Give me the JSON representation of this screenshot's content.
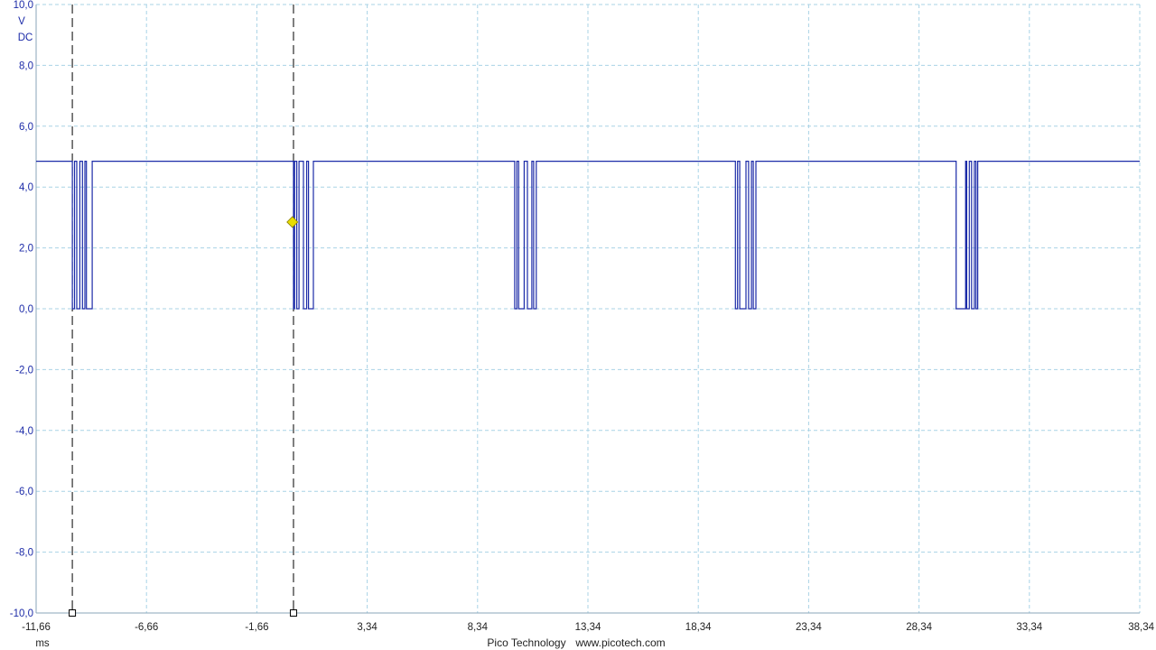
{
  "chart_data": {
    "type": "line",
    "title": "",
    "y_unit": "V",
    "y_coupling": "DC",
    "x_unit": "ms",
    "xlim": [
      -11.66,
      38.34
    ],
    "ylim": [
      -10.0,
      10.0
    ],
    "x_ticks": [
      "-11,66",
      "-6,66",
      "-1,66",
      "3,34",
      "8,34",
      "13,34",
      "18,34",
      "23,34",
      "28,34",
      "33,34",
      "38,34"
    ],
    "y_ticks": [
      "10,0",
      "8,0",
      "6,0",
      "4,0",
      "2,0",
      "0,0",
      "-2,0",
      "-4,0",
      "-6,0",
      "-8,0",
      "-10,0"
    ],
    "grid": true,
    "series": [
      {
        "color": "#1c2ba8",
        "high_level": 4.85,
        "low_level": 0.0,
        "baseline_start_x": -11.66,
        "baseline_end_x": 38.34,
        "bursts": [
          {
            "edges": [
              -10.02,
              -9.92,
              -9.82,
              -9.68,
              -9.56,
              -9.45,
              -9.38,
              -9.12
            ]
          },
          {
            "edges": [
              0.0,
              0.05,
              0.15,
              0.25,
              0.45,
              0.6,
              0.68,
              0.9
            ]
          },
          {
            "edges": [
              10.02,
              10.12,
              10.2,
              10.45,
              10.6,
              10.8,
              10.88,
              11.0
            ]
          },
          {
            "edges": [
              20.02,
              20.12,
              20.22,
              20.5,
              20.62,
              20.75,
              20.83,
              20.95
            ]
          },
          {
            "edges": [
              30.02,
              30.45,
              30.5,
              30.62,
              30.72,
              30.85,
              30.92,
              31.0
            ]
          }
        ]
      }
    ],
    "rulers": [
      -10.02,
      0.0
    ],
    "trigger": {
      "x": -0.05,
      "y": 2.85,
      "color": "#e8dd00"
    }
  },
  "footer": {
    "brand": "Pico Technology",
    "url": "www.picotech.com"
  }
}
